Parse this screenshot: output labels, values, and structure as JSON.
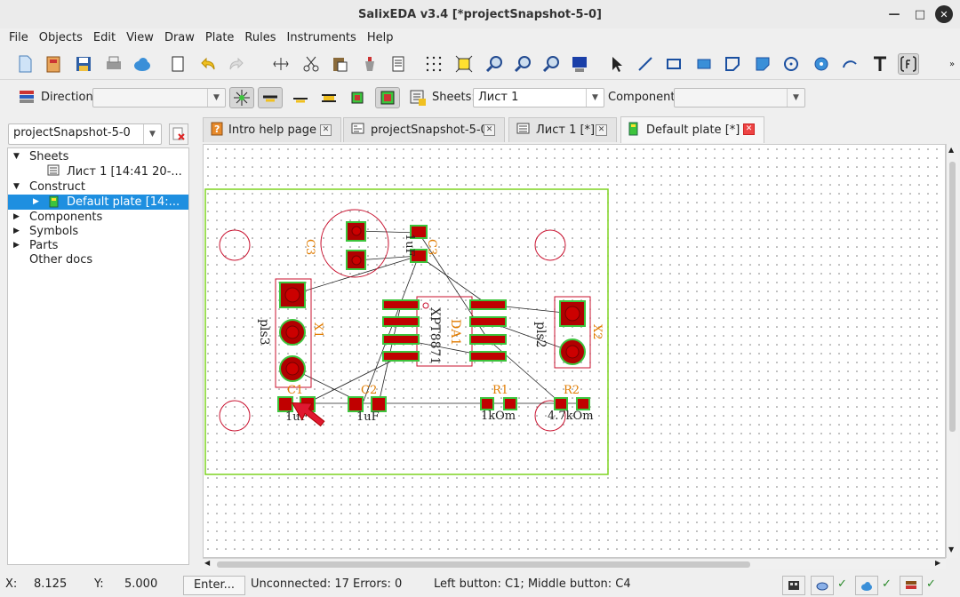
{
  "window": {
    "title": "SalixEDA v3.4 [*projectSnapshot-5-0]",
    "minimize": "—",
    "maximize": "□",
    "close": "✕"
  },
  "menu": [
    "File",
    "Objects",
    "Edit",
    "View",
    "Draw",
    "Plate",
    "Rules",
    "Instruments",
    "Help"
  ],
  "toolbar2": {
    "direction_label": "Direction:",
    "direction_value": "",
    "sheets_label": "Sheets:",
    "sheets_value": "Лист 1",
    "component_label": "Component:",
    "component_value": ""
  },
  "project_selector": "projectSnapshot-5-0",
  "tree": {
    "sheets": "Sheets",
    "sheet1": "Лист 1 [14:41 20-...",
    "construct": "Construct",
    "plate": "Default plate [14:...",
    "components": "Components",
    "symbols": "Symbols",
    "parts": "Parts",
    "other": "Other docs"
  },
  "tabs": [
    {
      "label": "Intro help page"
    },
    {
      "label": "projectSnapshot-5-0"
    },
    {
      "label": "Лист 1 [*]"
    },
    {
      "label": "Default plate [*]"
    }
  ],
  "pcb": {
    "labels": {
      "c3_top": "C3",
      "c3_rot": "C3",
      "c3_val": "1uF",
      "x1": "X1",
      "pls3": "pls3",
      "pls2": "pls2",
      "x2": "X2",
      "da1": "DA1",
      "xpt": "XPT8871",
      "c1": "C1",
      "c1_val": "1uF",
      "c2": "C2",
      "c2_val": "1uF",
      "r1": "R1",
      "r1_val": "1kOm",
      "r2": "R2",
      "r2_val": "4.7kOm"
    }
  },
  "status": {
    "x_label": "X:",
    "x_value": "8.125",
    "y_label": "Y:",
    "y_value": "5.000",
    "enter_button": "Enter...",
    "info": "Unconnected: 17  Errors: 0",
    "buttons": "Left button: C1;   Middle button: C4",
    "check": "✓"
  },
  "colors": {
    "accent": "#1e8fe0",
    "board_outline": "#7ed321",
    "pad": "#c00000",
    "pad_border": "#3cc43c",
    "silk": "#c8102e",
    "label": "#e07b00"
  }
}
